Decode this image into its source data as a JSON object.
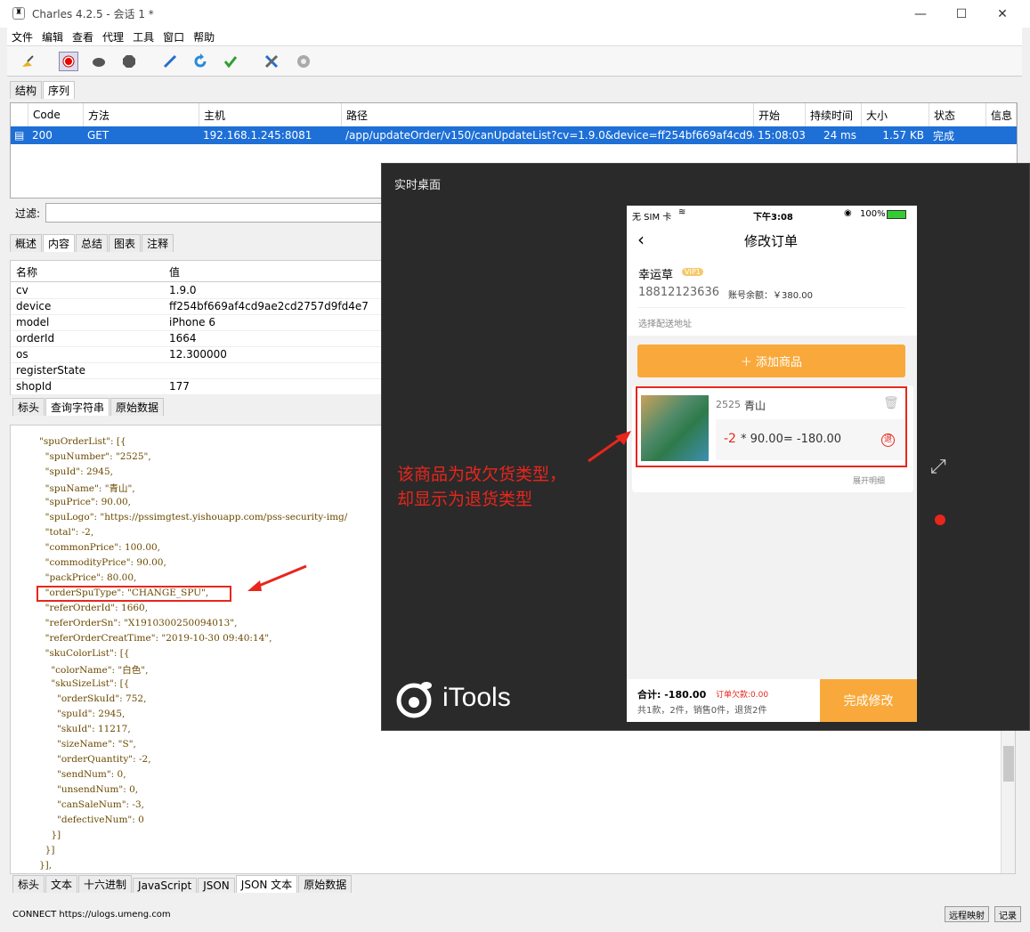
{
  "window": {
    "title": "Charles 4.2.5 - 会话 1 *",
    "min": "—",
    "max": "☐",
    "close": "✕"
  },
  "menu": [
    "文件",
    "编辑",
    "查看",
    "代理",
    "工具",
    "窗口",
    "帮助"
  ],
  "nav_tabs": [
    "结构",
    "序列"
  ],
  "columns": [
    "Code",
    "方法",
    "主机",
    "路径",
    "开始",
    "持续时间",
    "大小",
    "状态",
    "信息"
  ],
  "row": {
    "code": "200",
    "method": "GET",
    "host": "192.168.1.245:8081",
    "path": "/app/updateOrder/v150/canUpdateList?cv=1.9.0&device=ff254bf669af4cd9a...",
    "start": "15:08:03",
    "duration": "24 ms",
    "size": "1.57 KB",
    "status": "完成",
    "info": ""
  },
  "filter_label": "过滤:",
  "detail_tabs": [
    "概述",
    "内容",
    "总结",
    "图表",
    "注释"
  ],
  "kv_header": {
    "name": "名称",
    "value": "值"
  },
  "kv": [
    [
      "cv",
      "1.9.0"
    ],
    [
      "device",
      "ff254bf669af4cd9ae2cd2757d9fd4e7"
    ],
    [
      "model",
      "iPhone 6"
    ],
    [
      "orderId",
      "1664"
    ],
    [
      "os",
      "12.300000"
    ],
    [
      "registerState",
      ""
    ],
    [
      "shopId",
      "177"
    ]
  ],
  "req_tabs": [
    "标头",
    "查询字符串",
    "原始数据"
  ],
  "json_lines": [
    "\"spuOrderList\": [{",
    "  \"spuNumber\": \"2525\",",
    "  \"spuId\": 2945,",
    "  \"spuName\": \"青山\",",
    "  \"spuPrice\": 90.00,",
    "  \"spuLogo\": \"https://pssimgtest.yishouapp.com/pss-security-img/",
    "  \"total\": -2,",
    "  \"commonPrice\": 100.00,",
    "  \"commodityPrice\": 90.00,",
    "  \"packPrice\": 80.00,",
    "  \"orderSpuType\": \"CHANGE_SPU\",",
    "  \"referOrderId\": 1660,",
    "  \"referOrderSn\": \"X1910300250094013\",",
    "  \"referOrderCreatTime\": \"2019-10-30 09:40:14\",",
    "  \"skuColorList\": [{",
    "    \"colorName\": \"白色\",",
    "    \"skuSizeList\": [{",
    "      \"orderSkuId\": 752,",
    "      \"spuId\": 2945,",
    "      \"skuId\": 11217,",
    "      \"sizeName\": \"S\",",
    "      \"orderQuantity\": -2,",
    "      \"sendNum\": 0,",
    "      \"unsendNum\": 0,",
    "      \"canSaleNum\": -3,",
    "      \"defectiveNum\": 0",
    "    }]",
    "  }]",
    "}],"
  ],
  "resp_tabs": [
    "标头",
    "文本",
    "十六进制",
    "JavaScript",
    "JSON",
    "JSON 文本",
    "原始数据"
  ],
  "statusbar": "CONNECT https://ulogs.umeng.com",
  "status_buttons": [
    "远程映射",
    "记录"
  ],
  "itools": {
    "title": "实时桌面",
    "brand": "iTools",
    "phone": {
      "carrier": "无 SIM 卡",
      "time": "下午3:08",
      "battery": "100%",
      "page_title": "修改订单",
      "customer": "幸运草",
      "vip": "VIP1",
      "phone_no": "18812123636",
      "balance": "账号余额：￥380.00",
      "address": "选择配送地址",
      "add_btn": "＋ 添加商品",
      "item_code": "2525",
      "item_name": "青山",
      "qty": "-2",
      "formula": "* 90.00= -180.00",
      "return_tag": "退",
      "expand": "展开明细",
      "total": "合计: -180.00",
      "owed": "订单欠款:0.00",
      "summary": "共1款，2件，销售0件，退货2件",
      "submit": "完成修改"
    }
  },
  "annotation": [
    "该商品为改欠货类型，",
    "却显示为退货类型"
  ]
}
